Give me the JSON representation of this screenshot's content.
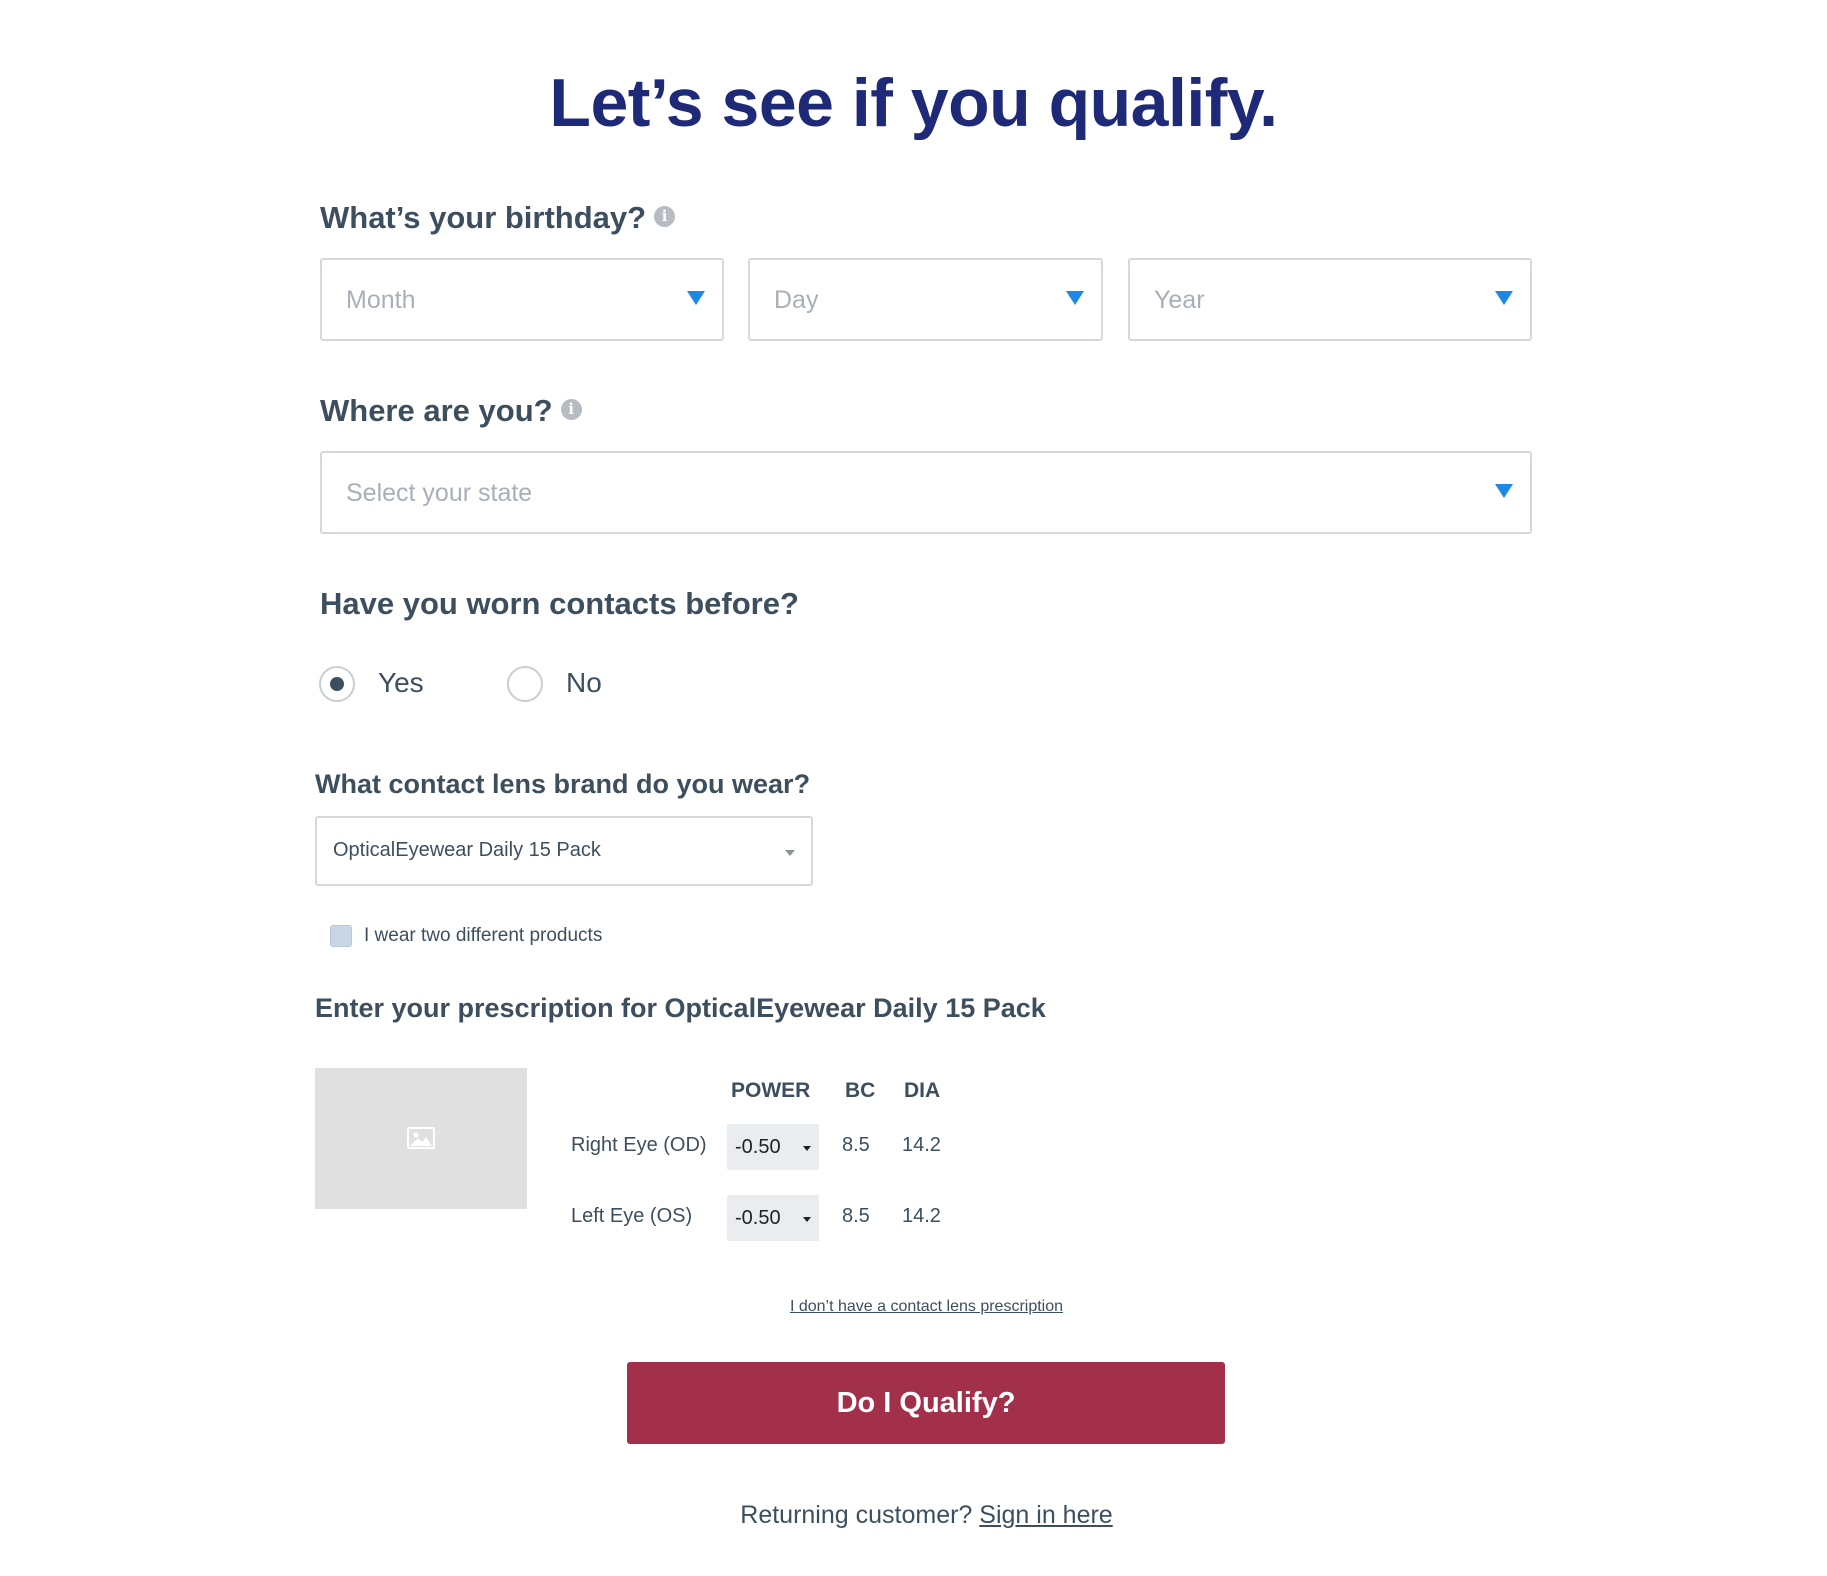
{
  "page": {
    "title": "Let’s see if you qualify."
  },
  "birthday": {
    "label": "What’s your birthday?",
    "info_icon": "info-icon",
    "month_placeholder": "Month",
    "day_placeholder": "Day",
    "year_placeholder": "Year"
  },
  "location": {
    "label": "Where are you?",
    "info_icon": "info-icon",
    "state_placeholder": "Select your state"
  },
  "contacts_before": {
    "label": "Have you worn contacts before?",
    "options": [
      {
        "label": "Yes",
        "selected": true
      },
      {
        "label": "No",
        "selected": false
      }
    ]
  },
  "brand": {
    "label": "What contact lens brand do you wear?",
    "selected": "OpticalEyewear Daily 15 Pack",
    "two_products_label": "I wear two different products",
    "two_products_checked": false
  },
  "prescription": {
    "heading": "Enter your prescription for OpticalEyewear Daily 15 Pack",
    "product_image_icon": "image-icon",
    "columns": [
      "POWER",
      "BC",
      "DIA"
    ],
    "rows": [
      {
        "eye": "Right Eye (OD)",
        "power": "-0.50",
        "bc": "8.5",
        "dia": "14.2"
      },
      {
        "eye": "Left Eye (OS)",
        "power": "-0.50",
        "bc": "8.5",
        "dia": "14.2"
      }
    ],
    "no_rx_link": "I don’t have a contact lens prescription"
  },
  "cta": {
    "label": "Do I Qualify?"
  },
  "footer": {
    "returning_text": "Returning customer?",
    "sign_in_link": "Sign in here"
  },
  "colors": {
    "title": "#1e2a78",
    "text": "#3d4f5e",
    "accent_caret": "#1e88e5",
    "cta": "#a3304a"
  }
}
